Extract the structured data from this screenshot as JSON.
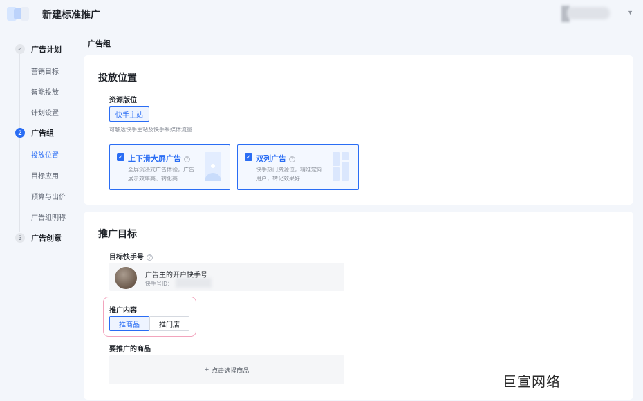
{
  "header": {
    "title": "新建标准推广"
  },
  "nav": {
    "steps": [
      {
        "index": "✓",
        "label": "广告计划",
        "state": "done"
      },
      {
        "index": "2",
        "label": "广告组",
        "state": "active"
      },
      {
        "index": "3",
        "label": "广告创意",
        "state": "todo"
      }
    ],
    "plan_items": [
      "营销目标",
      "智能投放",
      "计划设置"
    ],
    "group_items": [
      "投放位置",
      "目标应用",
      "预算与出价",
      "广告组明称"
    ]
  },
  "main": {
    "breadcrumb": "广告组",
    "placement": {
      "title": "投放位置",
      "resource_label": "资源版位",
      "resource_value": "快手主站",
      "resource_hint": "可触达快手主站及快手系媒体流量",
      "options": [
        {
          "title": "上下滑大屏广告",
          "desc": "全屏沉浸式广告体验，广告展示效率高、转化高"
        },
        {
          "title": "双列广告",
          "desc": "快手热门资源位，精准定向用户，转化效果好"
        }
      ]
    },
    "target": {
      "title": "推广目标",
      "account_label": "目标快手号",
      "account_name": "广告主的开户快手号",
      "account_id_prefix": "快手号ID：",
      "content_label": "推广内容",
      "content_options": [
        "推商品",
        "推门店"
      ],
      "selected_content": "推商品",
      "product_label": "要推广的商品",
      "choose_product": "点击选择商品"
    }
  },
  "watermark": "巨宣网络",
  "colors": {
    "accent": "#2a6df4",
    "highlight": "#f2a4bd",
    "background": "#f3f6fb"
  }
}
